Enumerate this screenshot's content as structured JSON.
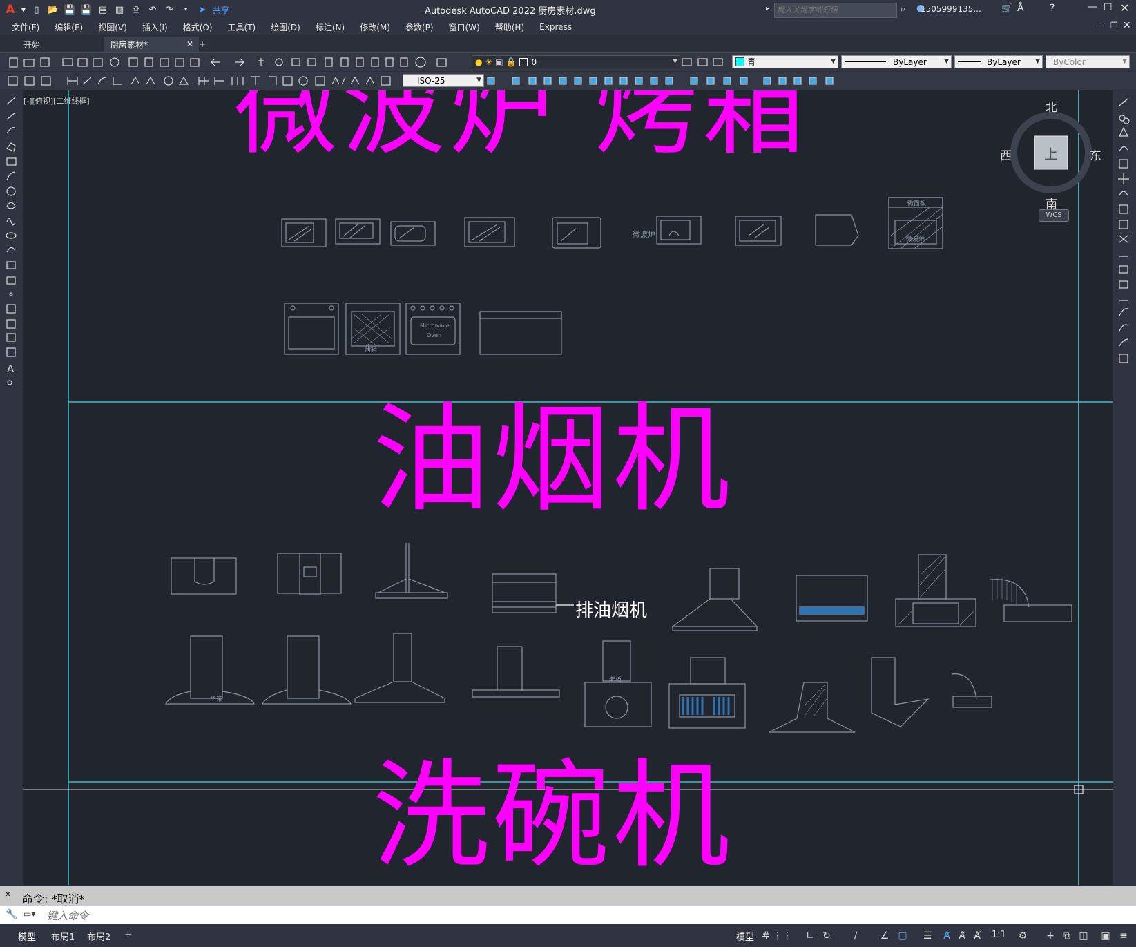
{
  "app": {
    "title": "Autodesk AutoCAD 2022    厨房素材.dwg",
    "share_label": "共享",
    "search_placeholder": "键入关键字或短语",
    "user": "1505999135..."
  },
  "menu": [
    "文件(F)",
    "编辑(E)",
    "视图(V)",
    "插入(I)",
    "格式(O)",
    "工具(T)",
    "绘图(D)",
    "标注(N)",
    "修改(M)",
    "参数(P)",
    "窗口(W)",
    "帮助(H)",
    "Express"
  ],
  "tabs": {
    "start": "开始",
    "doc": "厨房素材*",
    "add": "+"
  },
  "props": {
    "layer": "0",
    "color": "青",
    "linetype": "ByLayer",
    "lineweight": "ByLayer",
    "plotstyle": "ByColor",
    "dimstyle": "ISO-25"
  },
  "viewport_label": "[-][俯视][二维线框]",
  "viewcube": {
    "north": "北",
    "south": "南",
    "east": "东",
    "west": "西",
    "face": "上",
    "wcs": "WCS"
  },
  "drawing": {
    "section1_title": "微波炉 烤箱",
    "section2_title": "油烟机",
    "section3_title": "洗碗机",
    "microwave_caption": "微波炉",
    "panel_caption_top": "微面板",
    "panel_caption_mid": "微波炉",
    "oven_caption": "烤箱",
    "oven_brand_1": "Microwave",
    "oven_brand_2": "Oven",
    "hood_annotation": "排油烟机",
    "hood_brand_1": "华帝",
    "hood_brand_2": "老板"
  },
  "command": {
    "history": "命令: *取消*",
    "placeholder": "键入命令"
  },
  "layout_tabs": [
    "模型",
    "布局1",
    "布局2",
    "+"
  ],
  "status": {
    "model": "模型",
    "scale": "1:1"
  },
  "colors": {
    "magenta": "#ff00ff",
    "cyan": "#2fc4cf",
    "equip": "#8a95a5"
  }
}
